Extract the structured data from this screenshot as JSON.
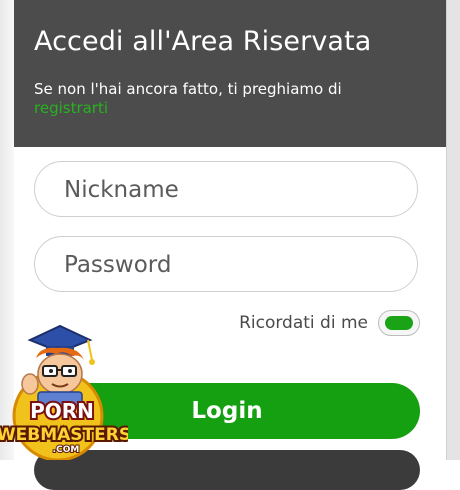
{
  "header": {
    "title": "Accedi all'Area Riservata",
    "subtitle_text": "Se non l'hai ancora fatto, ti preghiamo di",
    "register_link": "registrarti"
  },
  "form": {
    "nickname_placeholder": "Nickname",
    "password_placeholder": "Password",
    "remember_label": "Ricordati di me",
    "remember_checked": true,
    "login_label": "Login"
  },
  "logo": {
    "line1": "PORN",
    "line2": "WEBMASTERS",
    "line3": ".COM"
  },
  "colors": {
    "header_bg": "#4b4c4b",
    "accent_green": "#15a012",
    "link_green": "#27b21f"
  }
}
